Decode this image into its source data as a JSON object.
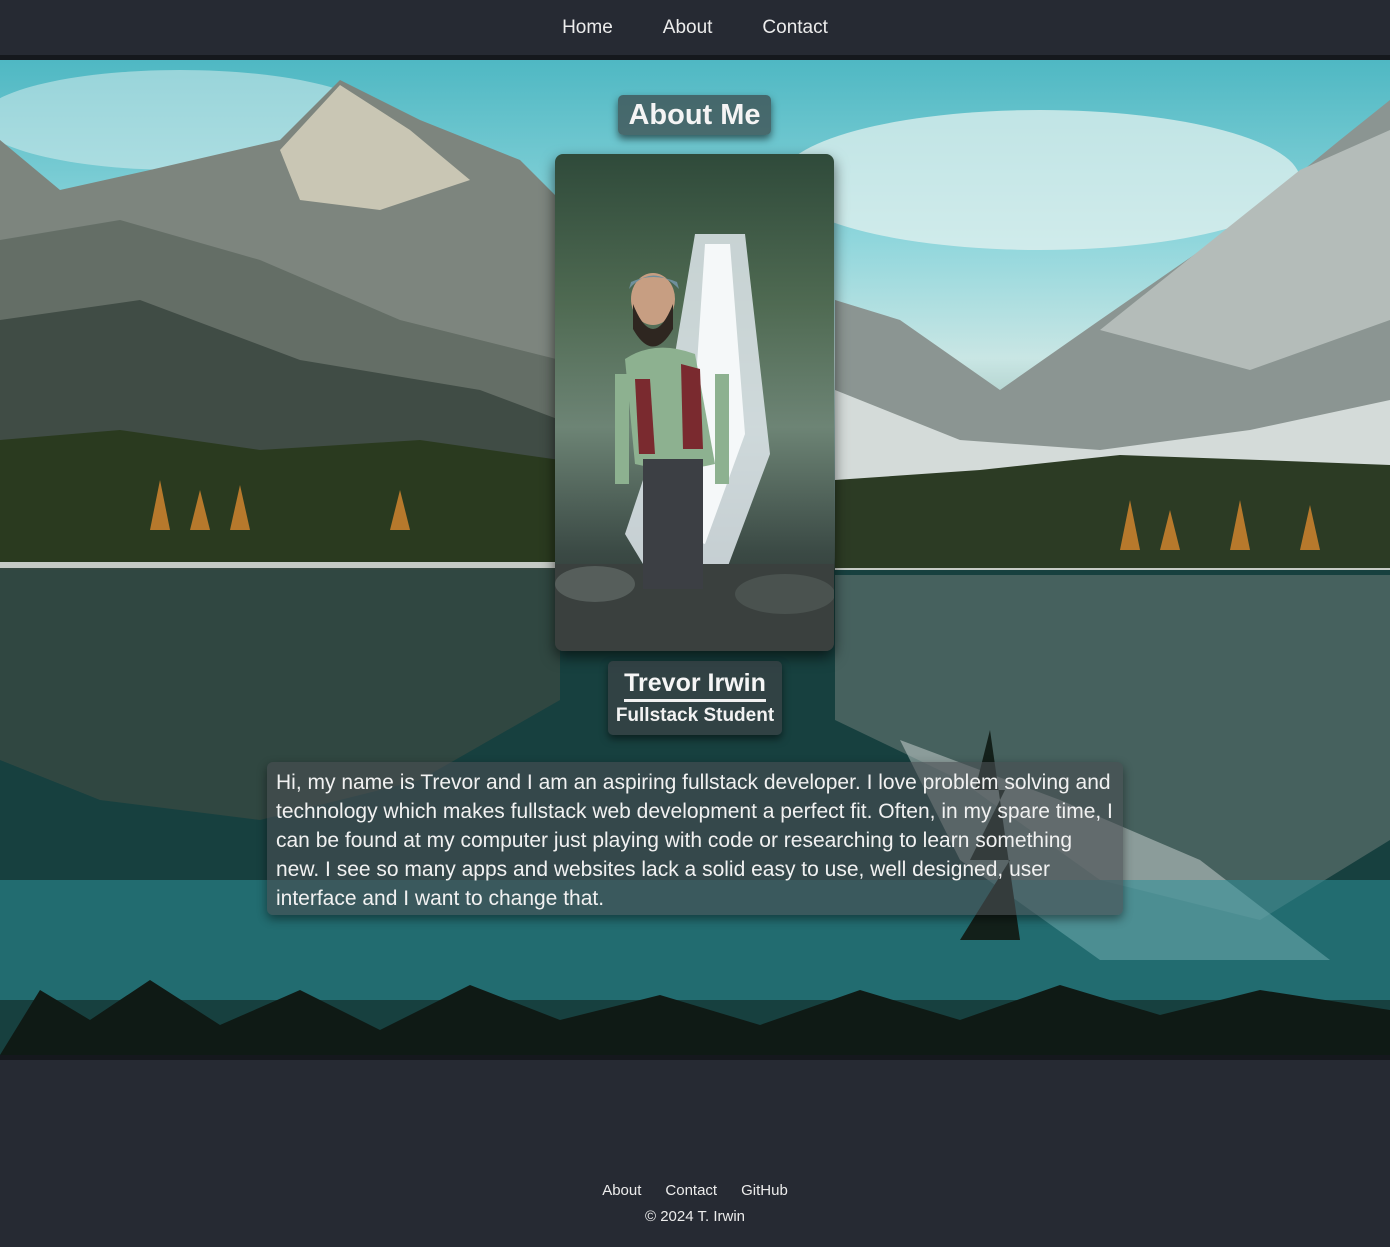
{
  "nav": {
    "home": "Home",
    "about": "About",
    "contact": "Contact"
  },
  "about": {
    "title": "About Me",
    "name": "Trevor Irwin",
    "role": "Fullstack Student",
    "bio": "Hi, my name is Trevor and I am an aspiring fullstack developer. I love problem solving and technology which makes fullstack web development a perfect fit. Often, in my spare time, I can be found at my computer just playing with code or researching to learn something new. I see so many apps and websites lack a solid easy to use, well designed, user interface and I want to change that."
  },
  "footer": {
    "about": "About",
    "contact": "Contact",
    "github": "GitHub",
    "copyright": "© 2024 T. Irwin"
  },
  "colors": {
    "page_bg": "#262a33",
    "rule": "#15181d",
    "text": "#f2f2f2"
  }
}
